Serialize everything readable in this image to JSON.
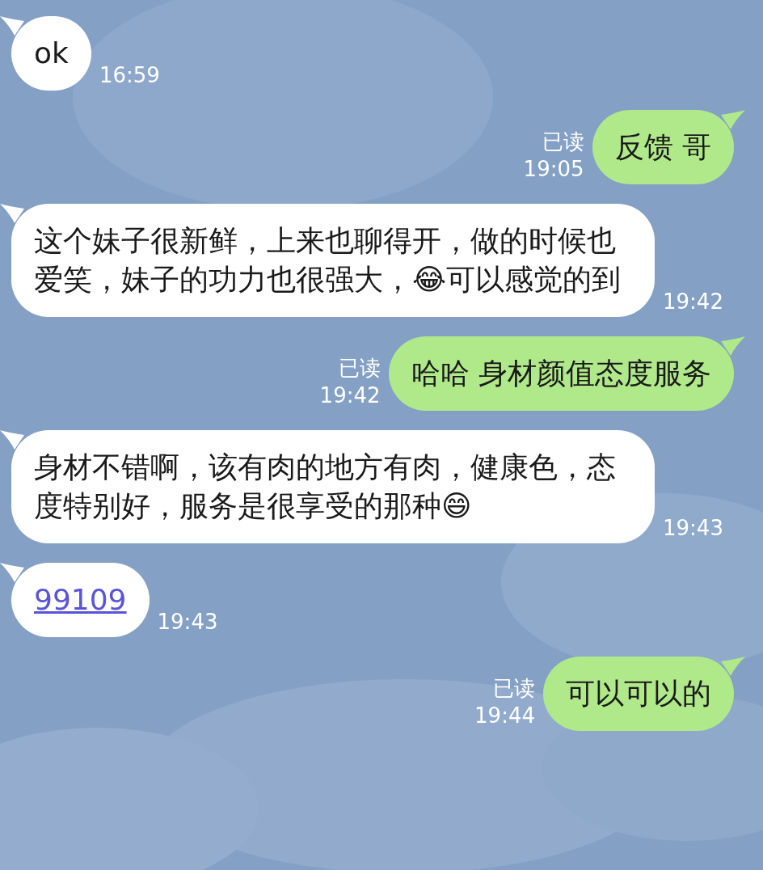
{
  "messages": [
    {
      "sent": false,
      "kind": "text",
      "text": "ok",
      "time": "16:59"
    },
    {
      "sent": true,
      "kind": "text",
      "text": "反馈 哥",
      "time": "19:05",
      "status": "已读"
    },
    {
      "sent": false,
      "kind": "text",
      "text": "这个妹子很新鲜，上来也聊得开，做的时候也爱笑，妹子的功力也很强大，😂可以感觉的到",
      "time": "19:42"
    },
    {
      "sent": true,
      "kind": "text",
      "text": "哈哈 身材颜值态度服务",
      "time": "19:42",
      "status": "已读"
    },
    {
      "sent": false,
      "kind": "text",
      "text": "身材不错啊，该有肉的地方有肉，健康色，态度特别好，服务是很享受的那种😄",
      "time": "19:43"
    },
    {
      "sent": false,
      "kind": "link",
      "text": "99109",
      "time": "19:43"
    },
    {
      "sent": true,
      "kind": "text",
      "text": "可以可以的",
      "time": "19:44",
      "status": "已读"
    }
  ]
}
